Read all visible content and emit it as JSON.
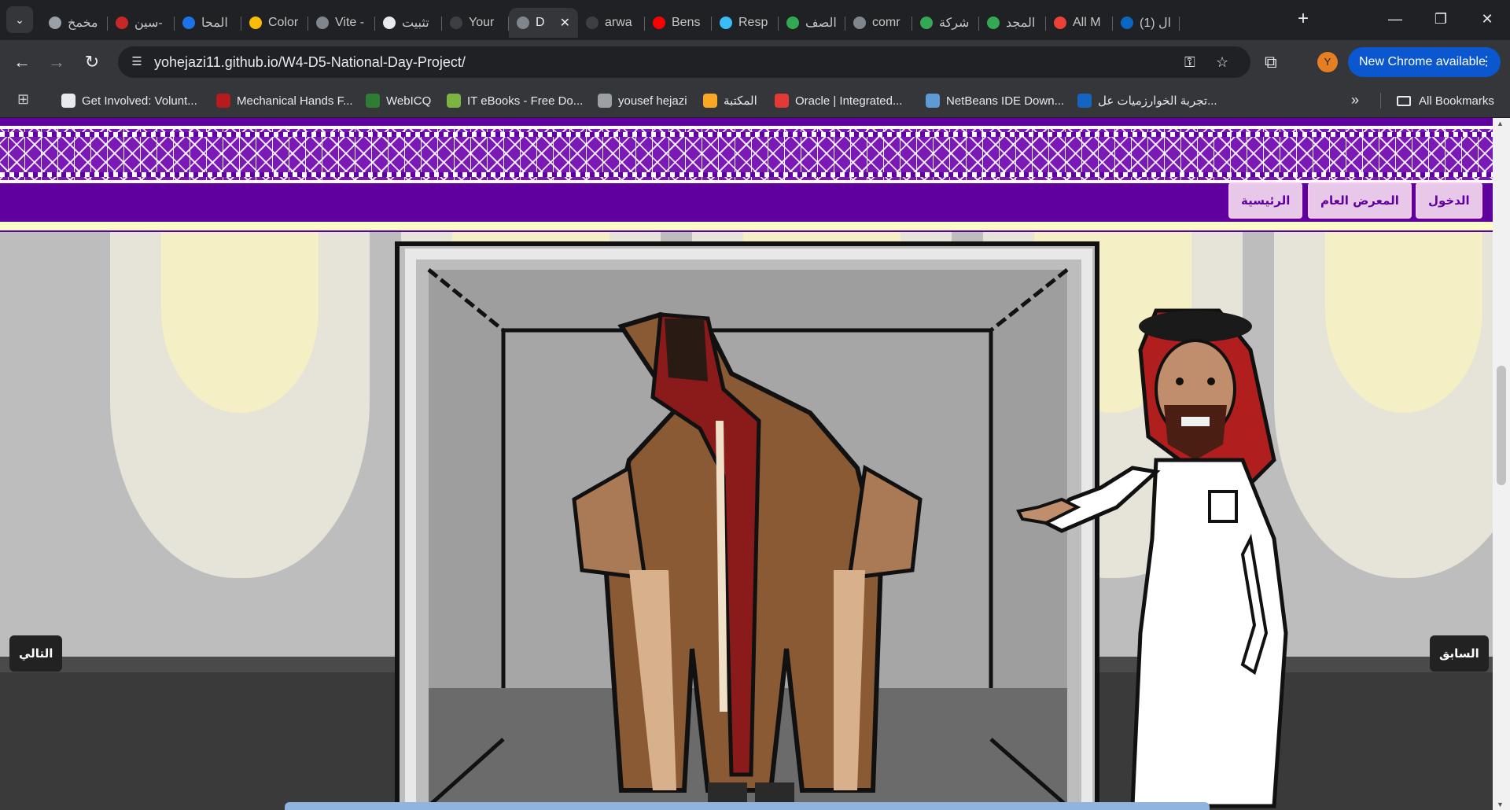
{
  "browser": {
    "tabs": [
      {
        "title": "مخمخ -",
        "favicon": "dot-icon",
        "active": false
      },
      {
        "title": "سين-",
        "favicon": "sin-logo-icon",
        "active": false
      },
      {
        "title": "المحا",
        "favicon": "circle-blue-icon",
        "active": false
      },
      {
        "title": "Color",
        "favicon": "shield-icon",
        "active": false
      },
      {
        "title": "Vite -",
        "favicon": "globe-icon",
        "active": false
      },
      {
        "title": "تثبيت",
        "favicon": "openai-icon",
        "active": false
      },
      {
        "title": "Your",
        "favicon": "github-icon",
        "active": false
      },
      {
        "title": "D",
        "favicon": "globe-icon",
        "active": true
      },
      {
        "title": "arwa",
        "favicon": "github-icon",
        "active": false
      },
      {
        "title": "Bens",
        "favicon": "youtube-icon",
        "active": false
      },
      {
        "title": "Resp",
        "favicon": "tailwind-icon",
        "active": false
      },
      {
        "title": "الصف",
        "favicon": "sheet-icon",
        "active": false
      },
      {
        "title": "comr",
        "favicon": "globe-icon",
        "active": false
      },
      {
        "title": "شركة",
        "favicon": "maps-pin-icon",
        "active": false
      },
      {
        "title": "المجد",
        "favicon": "maps-pin-icon",
        "active": false
      },
      {
        "title": "All M",
        "favicon": "gmail-icon",
        "active": false
      },
      {
        "title": "(1) ال",
        "favicon": "linkedin-icon",
        "active": false
      }
    ],
    "new_tab": "+",
    "window_controls": {
      "minimize": "—",
      "restore": "❐",
      "close": "✕"
    },
    "url": "yohejazi11.github.io/W4-D5-National-Day-Project/",
    "update_button": "New Chrome available",
    "avatar_letter": "Y",
    "bookmarks": [
      {
        "label": "Get Involved: Volunt...",
        "icon": "m-logo-icon"
      },
      {
        "label": "Mechanical Hands F...",
        "icon": "hands-logo-icon"
      },
      {
        "label": "WebICQ",
        "icon": "icq-flower-icon"
      },
      {
        "label": "IT eBooks - Free Do...",
        "icon": "green-ball-icon"
      },
      {
        "label": "yousef hejazi",
        "icon": "globe-icon"
      },
      {
        "label": "المكتبة",
        "icon": "library-logo-icon"
      },
      {
        "label": "Oracle | Integrated...",
        "icon": "oracle-icon"
      },
      {
        "label": "NetBeans IDE Down...",
        "icon": "netbeans-icon"
      },
      {
        "label": "تجربة الخوارزميات عل...",
        "icon": "h-logo-icon"
      }
    ],
    "all_bookmarks": "All Bookmarks"
  },
  "page": {
    "nav": {
      "login": "الدخول",
      "gallery": "المعرض العام",
      "home": "الرئيسية"
    },
    "prev": "السابق",
    "next": "التالي"
  },
  "colors": {
    "header_purple": "#60009e",
    "nav_button_bg": "#e8c8e8",
    "slide_button_bg": "#222222"
  }
}
